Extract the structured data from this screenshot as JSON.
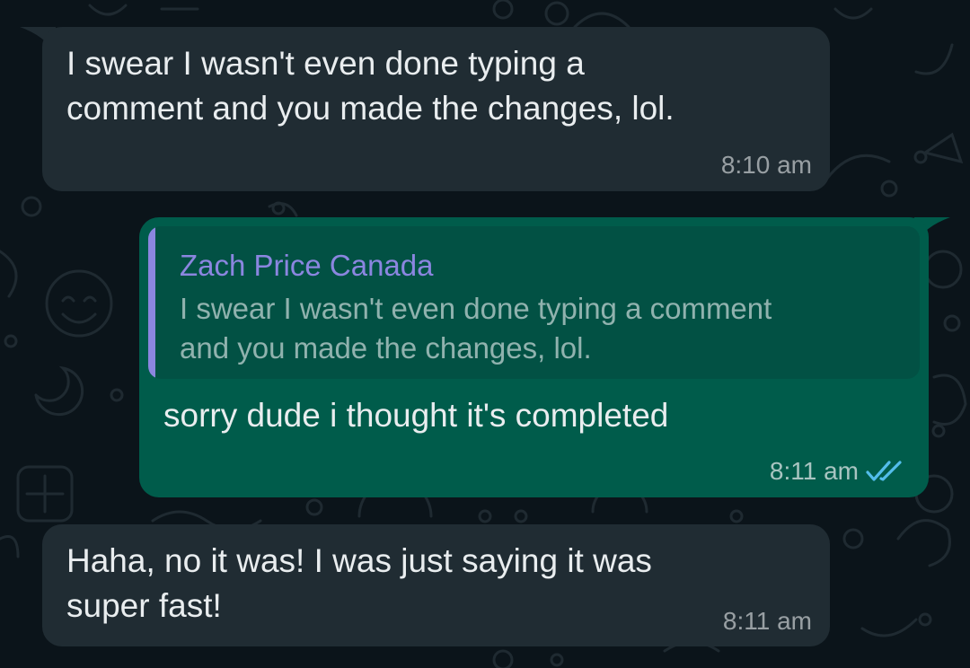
{
  "messages": [
    {
      "direction": "incoming",
      "text": "I swear I wasn't even done typing a\ncomment and you made the changes, lol.",
      "time": "8:10 am"
    },
    {
      "direction": "outgoing",
      "reply_to": {
        "author": "Zach Price Canada",
        "text": "I swear I wasn't even done typing a comment\nand you made the changes, lol."
      },
      "text": "sorry dude i thought it's completed",
      "time": "8:11 am",
      "status": "read",
      "status_icon": "double-check-icon"
    },
    {
      "direction": "incoming",
      "text": "Haha, no it was! I was just saying it was\nsuper fast!",
      "time": "8:11 am"
    }
  ],
  "colors": {
    "background": "#0b141a",
    "incoming_bubble": "#202c33",
    "outgoing_bubble": "#005c4b",
    "quote_background": "#025144",
    "quote_accent": "#8b86e0",
    "read_ticks": "#53bdeb"
  }
}
